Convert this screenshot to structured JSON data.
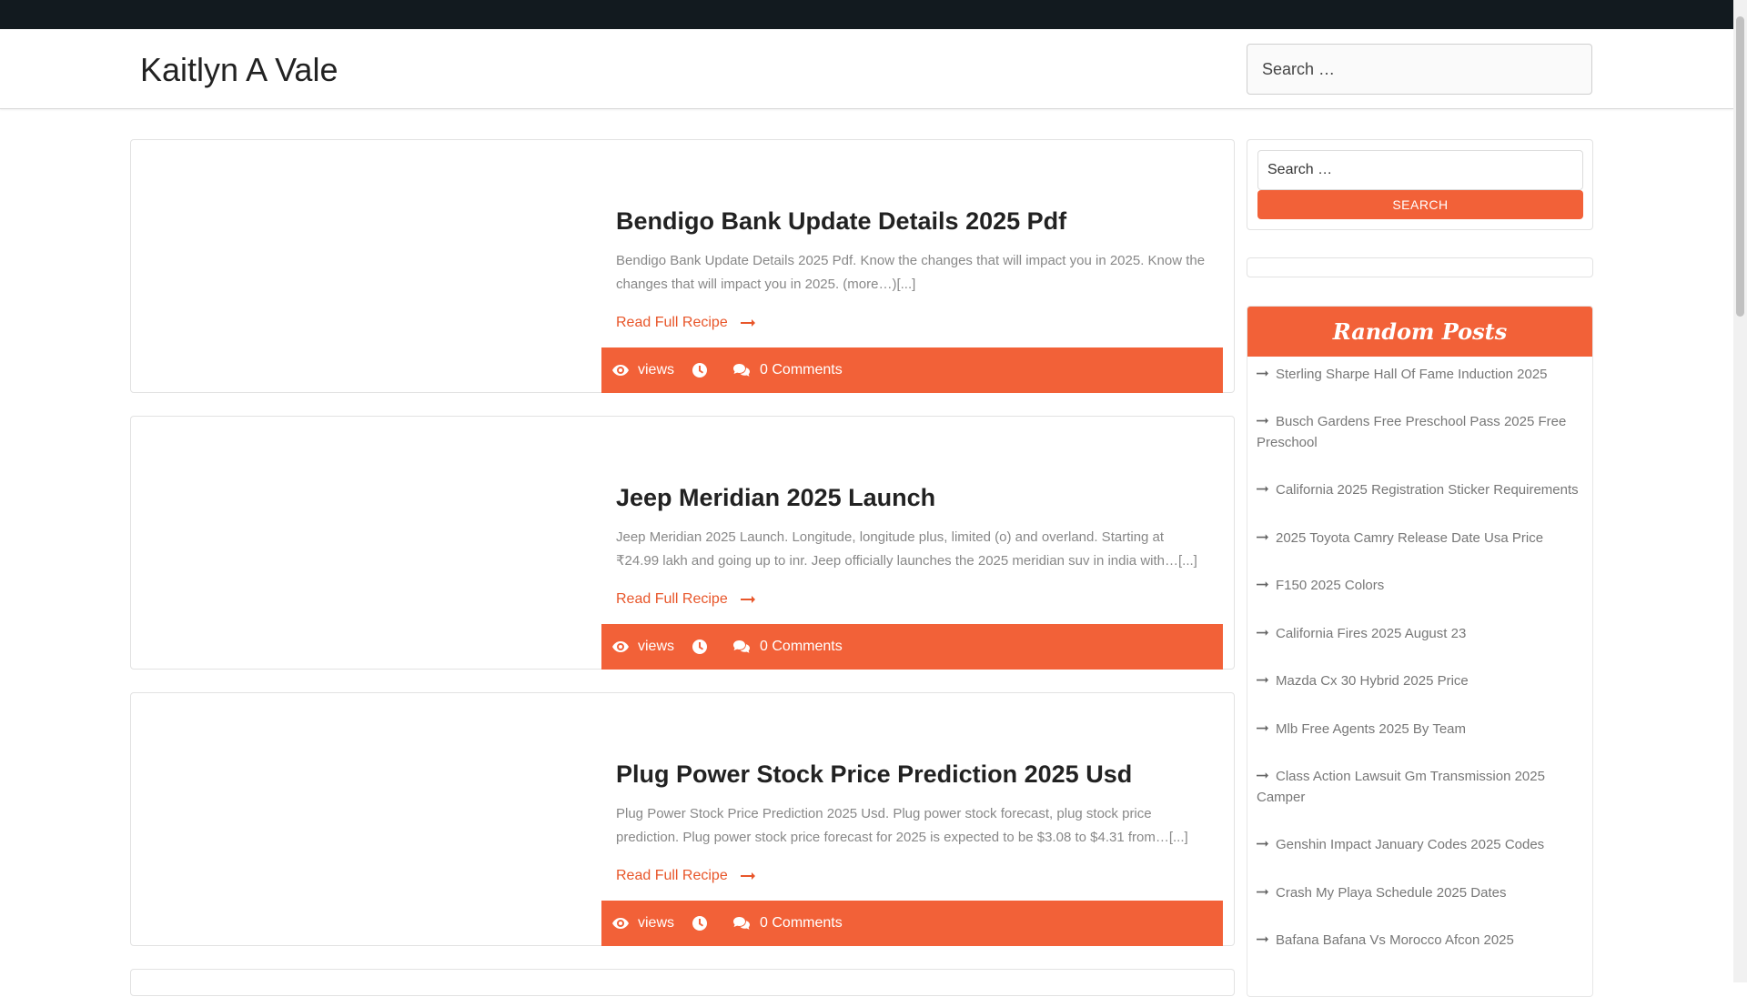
{
  "site": {
    "title": "Kaitlyn A Vale"
  },
  "header_search": {
    "placeholder": "Search …"
  },
  "posts": [
    {
      "title": "Bendigo Bank Update Details 2025 Pdf",
      "excerpt": "Bendigo Bank Update Details 2025 Pdf. Know the changes that will impact you in 2025. Know the changes that will impact you in 2025. (more…)[...]",
      "read_more": "Read Full Recipe",
      "views_label": "views",
      "comments": "0 Comments"
    },
    {
      "title": "Jeep Meridian 2025 Launch",
      "excerpt": "Jeep Meridian 2025 Launch. Longitude, longitude plus, limited (o) and overland. Starting at ₹24.99 lakh and going up to inr. Jeep officially launches the 2025 meridian suv in india with…[...]",
      "read_more": "Read Full Recipe",
      "views_label": "views",
      "comments": "0 Comments"
    },
    {
      "title": "Plug Power Stock Price Prediction 2025 Usd",
      "excerpt": "Plug Power Stock Price Prediction 2025 Usd. Plug power stock forecast, plug stock price prediction. Plug power stock price forecast for 2025 is expected to be $3.08 to $4.31 from…[...]",
      "read_more": "Read Full Recipe",
      "views_label": "views",
      "comments": "0 Comments"
    }
  ],
  "sidebar": {
    "search": {
      "placeholder": "Search …",
      "button": "SEARCH"
    },
    "random_posts": {
      "title": "Random Posts",
      "items": [
        "Sterling Sharpe Hall Of Fame Induction 2025",
        "Busch Gardens Free Preschool Pass 2025 Free Preschool",
        "California 2025 Registration Sticker Requirements",
        "2025 Toyota Camry Release Date Usa Price",
        "F150 2025 Colors",
        "California Fires 2025 August 23",
        "Mazda Cx 30 Hybrid 2025 Price",
        "Mlb Free Agents 2025 By Team",
        "Class Action Lawsuit Gm Transmission 2025 Camper",
        "Genshin Impact January Codes 2025 Codes",
        "Crash My Playa Schedule 2025 Dates",
        "Bafana Bafana Vs Morocco Afcon 2025"
      ]
    }
  },
  "colors": {
    "accent": "#f26138",
    "topbar": "#121a1f",
    "link": "#e8562a"
  },
  "icons": [
    "eye-icon",
    "clock-icon",
    "comments-icon",
    "arrow-right-icon"
  ]
}
